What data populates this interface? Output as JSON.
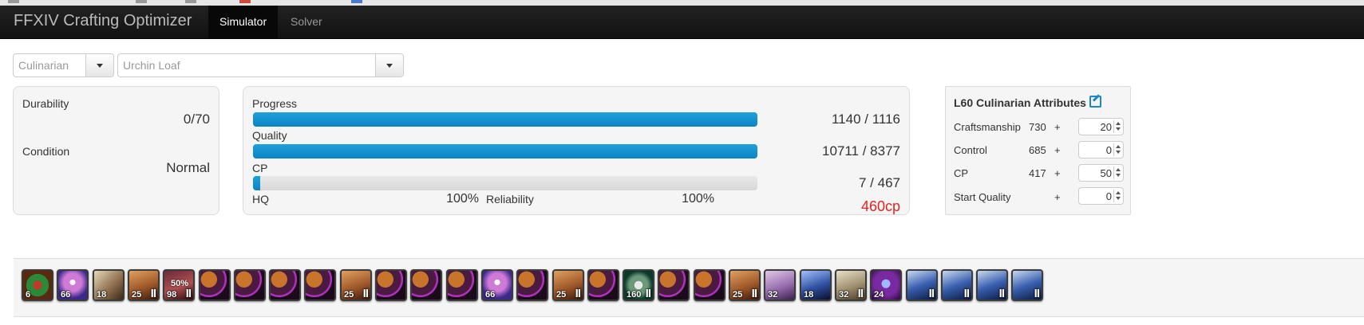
{
  "app": {
    "title": "FFXIV Crafting Optimizer"
  },
  "nav": {
    "tabs": [
      "Simulator",
      "Solver"
    ]
  },
  "selects": {
    "job": "Culinarian",
    "recipe": "Urchin Loaf"
  },
  "durability": {
    "label": "Durability",
    "value": "0/70"
  },
  "condition": {
    "label": "Condition",
    "value": "Normal"
  },
  "progress": {
    "label": "Progress",
    "value": "1140 / 1116",
    "fill_percent": 100
  },
  "quality": {
    "label": "Quality",
    "value": "10711 / 8377",
    "fill_percent": 100
  },
  "cp": {
    "label": "CP",
    "value": "7 / 467",
    "fill_percent": 1.5
  },
  "hq": {
    "label": "HQ",
    "value": "100%"
  },
  "reliability": {
    "label": "Reliability",
    "value": "100%"
  },
  "cp_cost": {
    "value": "460cp",
    "color": "#e8231f"
  },
  "attributes": {
    "title": "L60 Culinarian Attributes",
    "rows": [
      {
        "label": "Craftsmanship",
        "base": "730",
        "plus": "+",
        "bonus": "20"
      },
      {
        "label": "Control",
        "base": "685",
        "plus": "+",
        "bonus": "0"
      },
      {
        "label": "CP",
        "base": "417",
        "plus": "+",
        "bonus": "50"
      },
      {
        "label": "Start Quality",
        "base": "",
        "plus": "+",
        "bonus": "0"
      }
    ]
  },
  "colors": {
    "accent": "#1d86c8",
    "navbar": "#111111",
    "bar": "#0a83c4"
  },
  "action_icons": [
    {
      "name": "comfort-zone-icon",
      "num": "6",
      "roman": ""
    },
    {
      "name": "inner-quiet-icon",
      "num": "66",
      "roman": ""
    },
    {
      "name": "steady-hand-icon",
      "num": "18",
      "roman": ""
    },
    {
      "name": "hasty-touch-icon",
      "num": "25",
      "roman": "II"
    },
    {
      "name": "ingenuity-icon",
      "num": "98",
      "roman": "II"
    },
    {
      "name": "touch-action-icon",
      "num": "",
      "roman": ""
    },
    {
      "name": "touch-action-icon",
      "num": "",
      "roman": ""
    },
    {
      "name": "touch-action-icon",
      "num": "",
      "roman": ""
    },
    {
      "name": "touch-action-icon",
      "num": "",
      "roman": ""
    },
    {
      "name": "hasty-touch-icon",
      "num": "25",
      "roman": "II"
    },
    {
      "name": "touch-action-icon",
      "num": "",
      "roman": ""
    },
    {
      "name": "touch-action-icon",
      "num": "",
      "roman": ""
    },
    {
      "name": "touch-action-icon",
      "num": "",
      "roman": ""
    },
    {
      "name": "inner-quiet-icon",
      "num": "66",
      "roman": ""
    },
    {
      "name": "touch-action-icon",
      "num": "",
      "roman": ""
    },
    {
      "name": "hasty-touch-icon",
      "num": "25",
      "roman": "II"
    },
    {
      "name": "touch-action-icon",
      "num": "",
      "roman": ""
    },
    {
      "name": "manipulation-icon",
      "num": "160",
      "roman": "II"
    },
    {
      "name": "touch-action-icon",
      "num": "",
      "roman": ""
    },
    {
      "name": "touch-action-icon",
      "num": "",
      "roman": ""
    },
    {
      "name": "hasty-touch-icon",
      "num": "25",
      "roman": "II"
    },
    {
      "name": "great-strides-icon",
      "num": "32",
      "roman": ""
    },
    {
      "name": "innovation-icon",
      "num": "18",
      "roman": ""
    },
    {
      "name": "steady-hand-ii-icon",
      "num": "32",
      "roman": "II"
    },
    {
      "name": "byregots-blessing-icon",
      "num": "24",
      "roman": ""
    },
    {
      "name": "synthesis-icon",
      "num": "",
      "roman": "II"
    },
    {
      "name": "synthesis-icon",
      "num": "",
      "roman": "II"
    },
    {
      "name": "synthesis-icon",
      "num": "",
      "roman": "II"
    },
    {
      "name": "synthesis-icon",
      "num": "",
      "roman": "II"
    }
  ]
}
